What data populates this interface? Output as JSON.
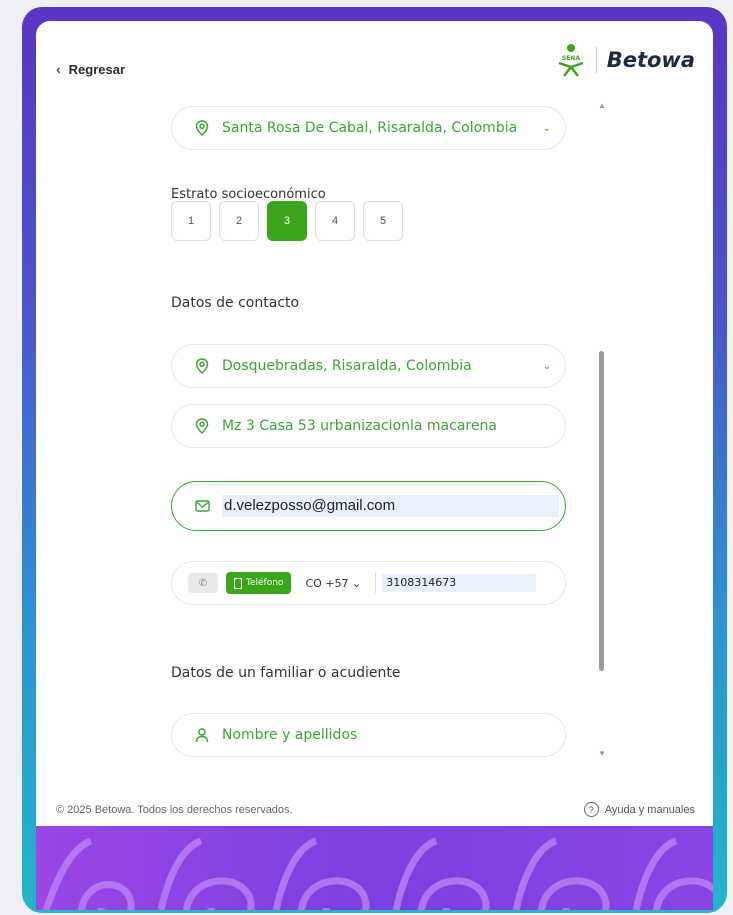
{
  "header": {
    "back_label": "Regresar",
    "brand": "Betowa",
    "sena_label": "SENA"
  },
  "form": {
    "birthplace": "Santa Rosa De Cabal, Risaralda, Colombia",
    "strata_label": "Estrato socioeconómico",
    "strata_options": [
      "1",
      "2",
      "3",
      "4",
      "5"
    ],
    "strata_selected": "3",
    "contact_section": "Datos de contacto",
    "residence": "Dosquebradas, Risaralda, Colombia",
    "address": "Mz 3 Casa 53 urbanizacionla macarena",
    "email": "d.velezposso@gmail.com",
    "phone_type": "Teléfono",
    "country_code": "CO +57",
    "phone_number": "3108314673",
    "relative_section": "Datos de un familiar o acudiente",
    "relative_name_placeholder": "Nombre y apellidos"
  },
  "footer": {
    "copyright": "© 2025 Betowa. Todos los derechos reservados.",
    "help": "Ayuda y manuales"
  },
  "colors": {
    "accent": "#3aa61a",
    "frame_top": "#5b35c4",
    "frame_bottom": "#1fb7c9",
    "band": "#8a44e4"
  }
}
